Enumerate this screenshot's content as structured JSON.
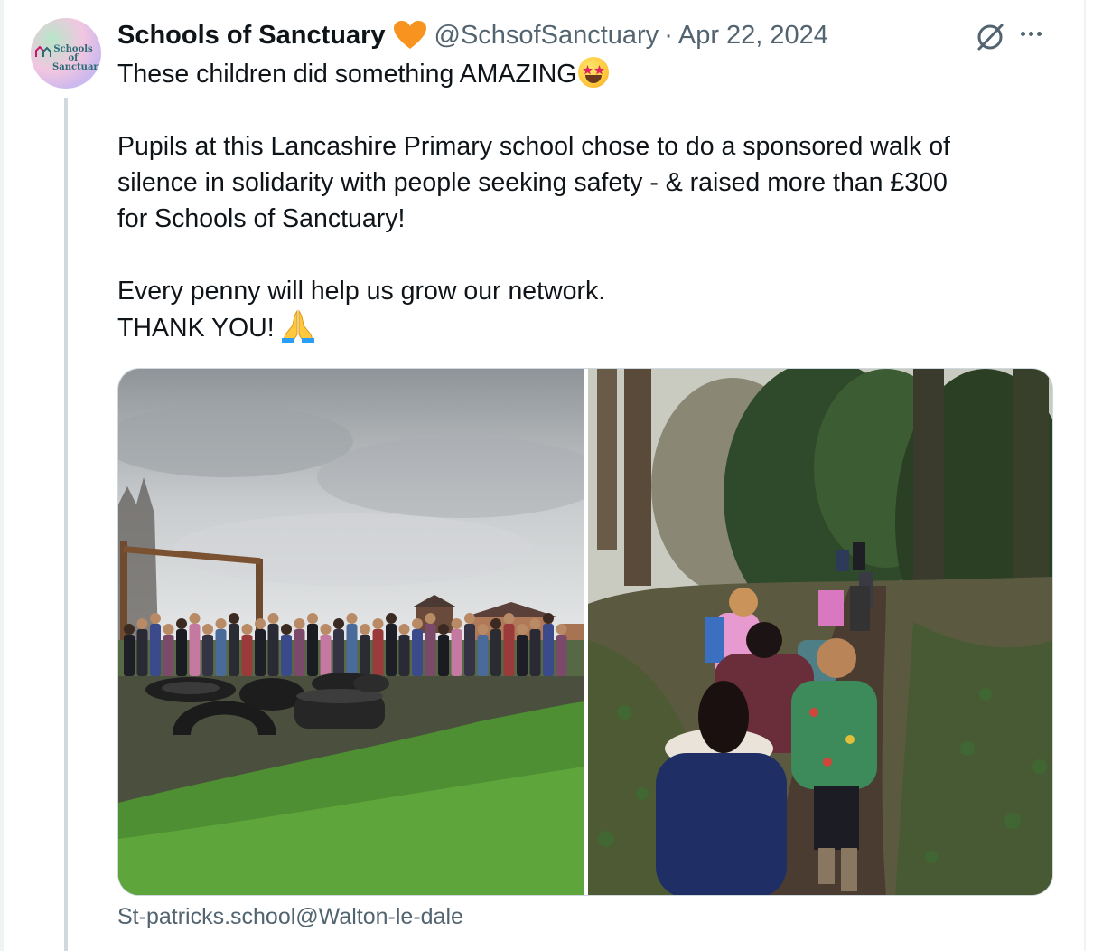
{
  "tweet": {
    "author": {
      "display_name": "Schools of Sanctuary",
      "handle": "@SchsofSanctuary",
      "avatar_logo_text": "Schools of Sanctuary",
      "badge_icon": "orange-heart-icon"
    },
    "separator": "·",
    "date": "Apr 22, 2024",
    "text_lines": [
      "These children did something AMAZING",
      "",
      "Pupils at this Lancashire Primary school chose to do a sponsored walk of",
      "silence in solidarity with people seeking safety - & raised more than £300",
      "for Schools of Sanctuary!",
      "",
      "Every penny will help us grow our network.",
      "THANK YOU!"
    ],
    "emojis": [
      "star-struck-emoji",
      "folded-hands-emoji"
    ],
    "media": [
      {
        "description_icon": "photo-children-playground"
      },
      {
        "description_icon": "photo-children-woodland-walk"
      }
    ],
    "caption": "St-patricks.school@Walton-le-dale"
  },
  "actions": {
    "grok_icon": "grok-icon",
    "more_icon": "more-options-icon"
  },
  "colors": {
    "text_primary": "#0f1419",
    "text_secondary": "#536471",
    "thread_line": "#cfd9de",
    "heart": "#f7931e"
  }
}
